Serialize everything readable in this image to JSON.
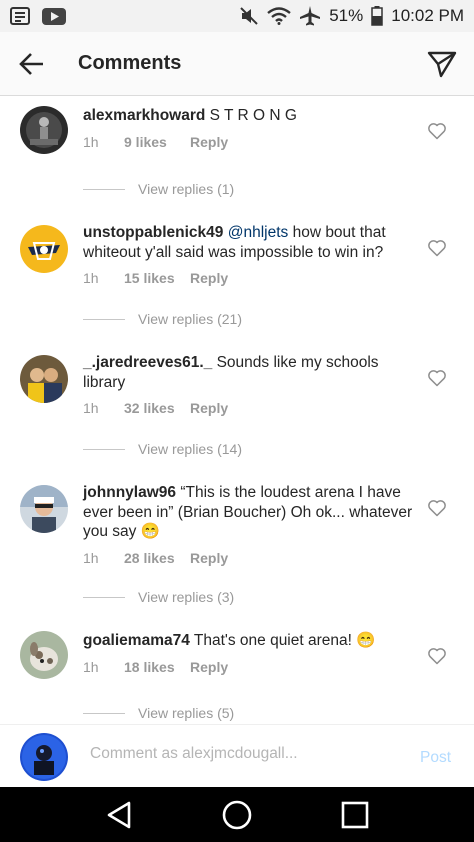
{
  "status_bar": {
    "battery_percent": "51%",
    "time": "10:02 PM",
    "icons": [
      "notification-list-icon",
      "youtube-icon",
      "mute-icon",
      "wifi-icon",
      "airplane-icon",
      "battery-icon"
    ]
  },
  "header": {
    "title": "Comments",
    "back_icon": "arrow-left-icon",
    "send_icon": "paper-plane-icon"
  },
  "comments": [
    {
      "username": "alexmarkhoward",
      "text": " S T R O N G",
      "mention": "",
      "time": "1h",
      "likes": "9 likes",
      "reply": "Reply",
      "view_replies": "View replies (1)"
    },
    {
      "username": "unstoppablenick49",
      "mention": "@nhljets",
      "text": " how bout that whiteout y'all said was impossible to win in?",
      "time": "1h",
      "likes": "15 likes",
      "reply": "Reply",
      "view_replies": "View replies (21)"
    },
    {
      "username": "_.jaredreeves61._",
      "mention": "",
      "text": " Sounds like my schools library",
      "time": "1h",
      "likes": "32 likes",
      "reply": "Reply",
      "view_replies": "View replies (14)"
    },
    {
      "username": "johnnylaw96",
      "mention": "",
      "text": " “This is the loudest arena I have ever been in” (Brian Boucher) Oh ok... whatever you say 😁",
      "time": "1h",
      "likes": "28 likes",
      "reply": "Reply",
      "view_replies": "View replies (3)"
    },
    {
      "username": "goaliemama74",
      "mention": "",
      "text": " That's one quiet arena! 😁",
      "time": "1h",
      "likes": "18 likes",
      "reply": "Reply",
      "view_replies": "View replies (5)"
    }
  ],
  "composer": {
    "placeholder": "Comment as alexjmcdougall...",
    "post_label": "Post"
  },
  "nav": {
    "icons": [
      "back-triangle-icon",
      "home-circle-icon",
      "recents-square-icon"
    ]
  }
}
